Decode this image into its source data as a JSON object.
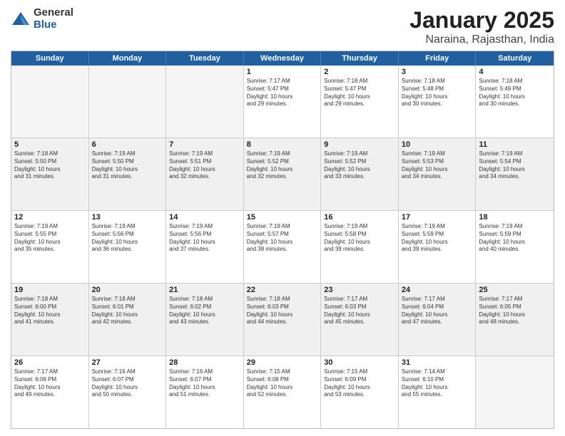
{
  "header": {
    "logo_general": "General",
    "logo_blue": "Blue",
    "title": "January 2025",
    "subtitle": "Naraina, Rajasthan, India"
  },
  "days_of_week": [
    "Sunday",
    "Monday",
    "Tuesday",
    "Wednesday",
    "Thursday",
    "Friday",
    "Saturday"
  ],
  "weeks": [
    [
      {
        "day": "",
        "info": "",
        "empty": true
      },
      {
        "day": "",
        "info": "",
        "empty": true
      },
      {
        "day": "",
        "info": "",
        "empty": true
      },
      {
        "day": "1",
        "info": "Sunrise: 7:17 AM\nSunset: 5:47 PM\nDaylight: 10 hours\nand 29 minutes.",
        "empty": false
      },
      {
        "day": "2",
        "info": "Sunrise: 7:18 AM\nSunset: 5:47 PM\nDaylight: 10 hours\nand 29 minutes.",
        "empty": false
      },
      {
        "day": "3",
        "info": "Sunrise: 7:18 AM\nSunset: 5:48 PM\nDaylight: 10 hours\nand 30 minutes.",
        "empty": false
      },
      {
        "day": "4",
        "info": "Sunrise: 7:18 AM\nSunset: 5:49 PM\nDaylight: 10 hours\nand 30 minutes.",
        "empty": false
      }
    ],
    [
      {
        "day": "5",
        "info": "Sunrise: 7:18 AM\nSunset: 5:50 PM\nDaylight: 10 hours\nand 31 minutes.",
        "empty": false
      },
      {
        "day": "6",
        "info": "Sunrise: 7:19 AM\nSunset: 5:50 PM\nDaylight: 10 hours\nand 31 minutes.",
        "empty": false
      },
      {
        "day": "7",
        "info": "Sunrise: 7:19 AM\nSunset: 5:51 PM\nDaylight: 10 hours\nand 32 minutes.",
        "empty": false
      },
      {
        "day": "8",
        "info": "Sunrise: 7:19 AM\nSunset: 5:52 PM\nDaylight: 10 hours\nand 32 minutes.",
        "empty": false
      },
      {
        "day": "9",
        "info": "Sunrise: 7:19 AM\nSunset: 5:52 PM\nDaylight: 10 hours\nand 33 minutes.",
        "empty": false
      },
      {
        "day": "10",
        "info": "Sunrise: 7:19 AM\nSunset: 5:53 PM\nDaylight: 10 hours\nand 34 minutes.",
        "empty": false
      },
      {
        "day": "11",
        "info": "Sunrise: 7:19 AM\nSunset: 5:54 PM\nDaylight: 10 hours\nand 34 minutes.",
        "empty": false
      }
    ],
    [
      {
        "day": "12",
        "info": "Sunrise: 7:19 AM\nSunset: 5:55 PM\nDaylight: 10 hours\nand 35 minutes.",
        "empty": false
      },
      {
        "day": "13",
        "info": "Sunrise: 7:19 AM\nSunset: 5:56 PM\nDaylight: 10 hours\nand 36 minutes.",
        "empty": false
      },
      {
        "day": "14",
        "info": "Sunrise: 7:19 AM\nSunset: 5:56 PM\nDaylight: 10 hours\nand 37 minutes.",
        "empty": false
      },
      {
        "day": "15",
        "info": "Sunrise: 7:19 AM\nSunset: 5:57 PM\nDaylight: 10 hours\nand 38 minutes.",
        "empty": false
      },
      {
        "day": "16",
        "info": "Sunrise: 7:19 AM\nSunset: 5:58 PM\nDaylight: 10 hours\nand 39 minutes.",
        "empty": false
      },
      {
        "day": "17",
        "info": "Sunrise: 7:19 AM\nSunset: 5:59 PM\nDaylight: 10 hours\nand 39 minutes.",
        "empty": false
      },
      {
        "day": "18",
        "info": "Sunrise: 7:19 AM\nSunset: 5:59 PM\nDaylight: 10 hours\nand 40 minutes.",
        "empty": false
      }
    ],
    [
      {
        "day": "19",
        "info": "Sunrise: 7:18 AM\nSunset: 6:00 PM\nDaylight: 10 hours\nand 41 minutes.",
        "empty": false
      },
      {
        "day": "20",
        "info": "Sunrise: 7:18 AM\nSunset: 6:01 PM\nDaylight: 10 hours\nand 42 minutes.",
        "empty": false
      },
      {
        "day": "21",
        "info": "Sunrise: 7:18 AM\nSunset: 6:02 PM\nDaylight: 10 hours\nand 43 minutes.",
        "empty": false
      },
      {
        "day": "22",
        "info": "Sunrise: 7:18 AM\nSunset: 6:03 PM\nDaylight: 10 hours\nand 44 minutes.",
        "empty": false
      },
      {
        "day": "23",
        "info": "Sunrise: 7:17 AM\nSunset: 6:03 PM\nDaylight: 10 hours\nand 45 minutes.",
        "empty": false
      },
      {
        "day": "24",
        "info": "Sunrise: 7:17 AM\nSunset: 6:04 PM\nDaylight: 10 hours\nand 47 minutes.",
        "empty": false
      },
      {
        "day": "25",
        "info": "Sunrise: 7:17 AM\nSunset: 6:05 PM\nDaylight: 10 hours\nand 48 minutes.",
        "empty": false
      }
    ],
    [
      {
        "day": "26",
        "info": "Sunrise: 7:17 AM\nSunset: 6:06 PM\nDaylight: 10 hours\nand 49 minutes.",
        "empty": false
      },
      {
        "day": "27",
        "info": "Sunrise: 7:16 AM\nSunset: 6:07 PM\nDaylight: 10 hours\nand 50 minutes.",
        "empty": false
      },
      {
        "day": "28",
        "info": "Sunrise: 7:16 AM\nSunset: 6:07 PM\nDaylight: 10 hours\nand 51 minutes.",
        "empty": false
      },
      {
        "day": "29",
        "info": "Sunrise: 7:15 AM\nSunset: 6:08 PM\nDaylight: 10 hours\nand 52 minutes.",
        "empty": false
      },
      {
        "day": "30",
        "info": "Sunrise: 7:15 AM\nSunset: 6:09 PM\nDaylight: 10 hours\nand 53 minutes.",
        "empty": false
      },
      {
        "day": "31",
        "info": "Sunrise: 7:14 AM\nSunset: 6:10 PM\nDaylight: 10 hours\nand 55 minutes.",
        "empty": false
      },
      {
        "day": "",
        "info": "",
        "empty": true
      }
    ]
  ]
}
